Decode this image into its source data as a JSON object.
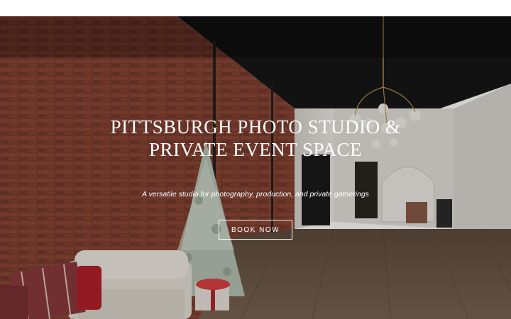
{
  "hero": {
    "title": "PITTSBURGH PHOTO STUDIO & PRIVATE EVENT SPACE",
    "tagline": "A versatile studio for photography, production, and private gatherings",
    "cta_label": "BOOK NOW"
  },
  "colors": {
    "brick": "#6e3a2e",
    "ceiling": "#161616",
    "floor": "#6d5a48",
    "wall": "#e6e2dc",
    "button_border": "#ffffff"
  }
}
